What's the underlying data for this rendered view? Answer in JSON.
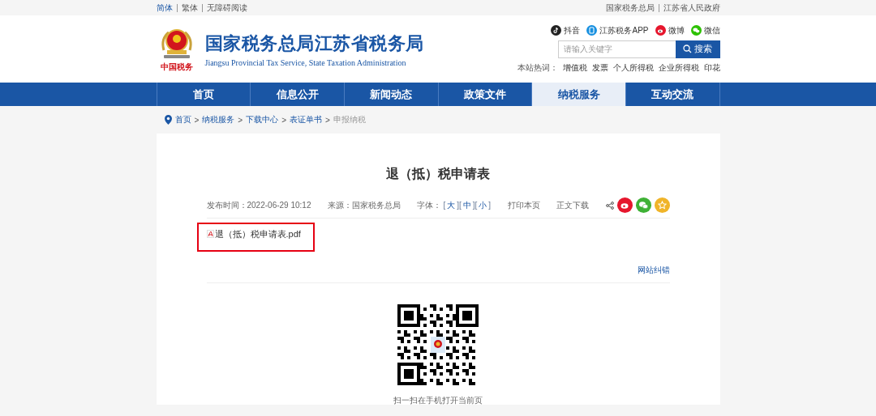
{
  "top_bar": {
    "left_links": [
      {
        "label": "简体",
        "selected": true
      },
      {
        "label": "繁体",
        "selected": false
      },
      {
        "label": "无障碍阅读",
        "selected": false
      }
    ],
    "right_links": [
      {
        "label": "国家税务总局"
      },
      {
        "label": "江苏省人民政府"
      }
    ]
  },
  "header": {
    "logo_caption": "中国税务",
    "title": "国家税务总局江苏省税务局",
    "subtitle": "Jiangsu Provincial Tax Service, State Taxation Administration",
    "social": [
      {
        "kind": "douyin",
        "label": "抖音"
      },
      {
        "kind": "app",
        "label": "江苏税务APP"
      },
      {
        "kind": "weibo",
        "label": "微博"
      },
      {
        "kind": "wechat",
        "label": "微信"
      }
    ],
    "search": {
      "placeholder": "请输入关键字",
      "button": "搜索"
    },
    "hot_words": {
      "label": "本站热词：",
      "items": [
        "增值税",
        "发票",
        "个人所得税",
        "企业所得税",
        "印花"
      ]
    }
  },
  "nav": [
    {
      "label": "首页",
      "selected": false
    },
    {
      "label": "信息公开",
      "selected": false
    },
    {
      "label": "新闻动态",
      "selected": false
    },
    {
      "label": "政策文件",
      "selected": false
    },
    {
      "label": "纳税服务",
      "selected": true
    },
    {
      "label": "互动交流",
      "selected": false
    }
  ],
  "breadcrumb": [
    {
      "label": "首页",
      "current": false
    },
    {
      "label": "纳税服务",
      "current": false
    },
    {
      "label": "下载中心",
      "current": false
    },
    {
      "label": "表证单书",
      "current": false
    },
    {
      "label": "申报纳税",
      "current": true
    }
  ],
  "breadcrumb_separator": ">",
  "article": {
    "title": "退（抵）税申请表",
    "published": "发布时间：2022-06-29 10:12",
    "source": "来源：国家税务总局",
    "font_size": {
      "label": "字体：",
      "parts": [
        {
          "kind": "bracket",
          "text": "["
        },
        {
          "kind": "option",
          "text": "大"
        },
        {
          "kind": "bracket",
          "text": "]["
        },
        {
          "kind": "option",
          "text": "中"
        },
        {
          "kind": "bracket",
          "text": "]["
        },
        {
          "kind": "option",
          "text": "小"
        },
        {
          "kind": "bracket",
          "text": "]"
        }
      ]
    },
    "print": "打印本页",
    "download": "正文下载",
    "share": [
      {
        "kind": "weibo",
        "color": "#e6162d"
      },
      {
        "kind": "wechat",
        "color": "#3eb135"
      },
      {
        "kind": "favorite",
        "color": "#f0b429"
      }
    ],
    "attachment": {
      "filename": "退（抵）税申请表.pdf",
      "highlighted": true
    },
    "report_link": "网站纠错",
    "qr_caption": "扫一扫在手机打开当前页"
  }
}
